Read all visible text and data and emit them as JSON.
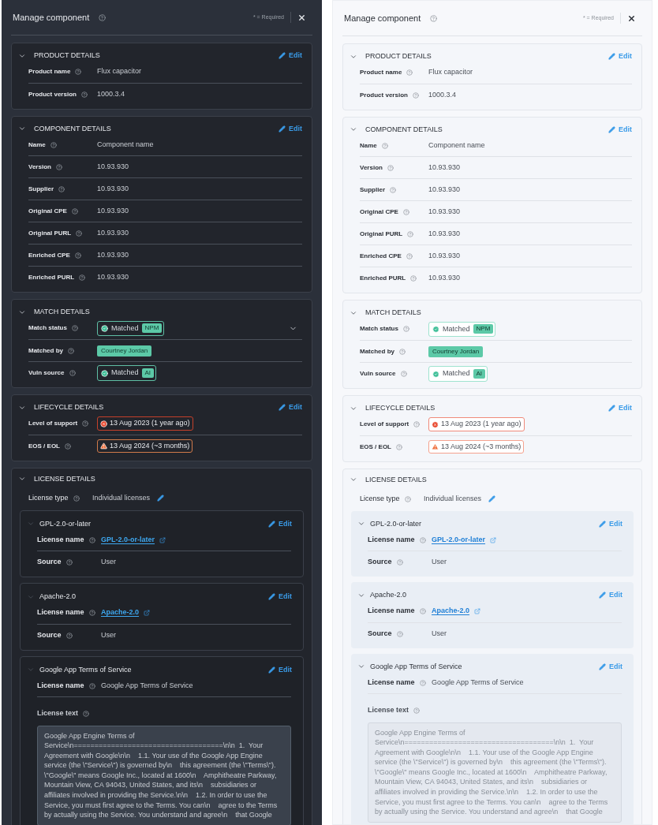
{
  "panels": [
    {
      "kind": "dark",
      "title": "Manage component",
      "required_note": "* = Required",
      "sections": [
        {
          "title": "PRODUCT DETAILS",
          "edit": "Edit",
          "rows": [
            {
              "kind": "text",
              "label": "Product name",
              "value": "Flux capacitor"
            },
            {
              "kind": "text",
              "label": "Product version",
              "value": "1000.3.4"
            }
          ]
        },
        {
          "title": "COMPONENT DETAILS",
          "edit": "Edit",
          "rows": [
            {
              "kind": "text",
              "label": "Name",
              "value": "Component name"
            },
            {
              "kind": "text",
              "label": "Version",
              "value": "10.93.930"
            },
            {
              "kind": "text",
              "label": "Supplier",
              "value": "10.93.930"
            },
            {
              "kind": "text",
              "label": "Original CPE",
              "value": "10.93.930"
            },
            {
              "kind": "text",
              "label": "Original PURL",
              "value": "10.93.930"
            },
            {
              "kind": "text",
              "label": "Enriched CPE",
              "value": "10.93.930"
            },
            {
              "kind": "text",
              "label": "Enriched PURL",
              "value": "10.93.930"
            }
          ]
        },
        {
          "title": "MATCH DETAILS",
          "rows": [
            {
              "kind": "status",
              "label": "Match status",
              "value": "Matched",
              "tag": "NPM",
              "dropdown": true
            },
            {
              "kind": "chip",
              "label": "Matched by",
              "value": "Courtney Jordan"
            },
            {
              "kind": "status",
              "label": "Vuln source",
              "value": "Matched",
              "tag": "AI",
              "dropdown": false
            }
          ]
        },
        {
          "title": "LIFECYCLE DETAILS",
          "edit": "Edit",
          "rows": [
            {
              "kind": "expired",
              "label": "Level of support",
              "value": "13 Aug 2023 (1 year ago)"
            },
            {
              "kind": "expiring",
              "label": "EOS / EOL",
              "value": "13 Aug 2024 (~3 months)"
            }
          ]
        }
      ],
      "license": {
        "title": "LICENSE DETAILS",
        "type_label": "License type",
        "type_value": "Individual licenses",
        "licenses": [
          {
            "title": "GPL-2.0-or-later",
            "edit": "Edit",
            "rows": [
              {
                "kind": "link",
                "label": "License name",
                "value": "GPL-2.0-or-later"
              },
              {
                "kind": "text",
                "label": "Source",
                "value": "User"
              }
            ]
          },
          {
            "title": "Apache-2.0",
            "edit": "Edit",
            "rows": [
              {
                "kind": "link",
                "label": "License name",
                "value": "Apache-2.0"
              },
              {
                "kind": "text",
                "label": "Source",
                "value": "User"
              }
            ]
          },
          {
            "title": "Google App Terms of Service",
            "edit": "Edit",
            "rows": [
              {
                "kind": "text",
                "label": "License name",
                "value": "Google App Terms of Service"
              },
              {
                "kind": "longtext",
                "label": "License text",
                "value": "Google App Engine Terms of\nService\\n====================================\\n\\n  1.  Your\nAgreement with Google\\n\\n    1.1. Your use of the Google App Engine\nservice (the \\\"Service\\\") is governed by\\n    this agreement (the \\\"Terms\\\").\n\\\"Google\\\" means Google Inc., located at 1600\\n    Amphitheatre Parkway,\nMountain View, CA 94043, United States, and its\\n    subsidiaries or\naffiliates involved in providing the Service.\\n\\n    1.2. In order to use the\nService, you must first agree to the Terms. You can\\n    agree to the Terms\nby actually using the Service. You understand and agree\\n    that Google"
              }
            ]
          }
        ]
      }
    },
    {
      "kind": "light",
      "title": "Manage component",
      "required_note": "* = Required",
      "sections": [
        {
          "title": "PRODUCT DETAILS",
          "edit": "Edit",
          "rows": [
            {
              "kind": "text",
              "label": "Product name",
              "value": "Flux capacitor"
            },
            {
              "kind": "text",
              "label": "Product version",
              "value": "1000.3.4"
            }
          ]
        },
        {
          "title": "COMPONENT DETAILS",
          "edit": "Edit",
          "rows": [
            {
              "kind": "text",
              "label": "Name",
              "value": "Component name"
            },
            {
              "kind": "text",
              "label": "Version",
              "value": "10.93.930"
            },
            {
              "kind": "text",
              "label": "Supplier",
              "value": "10.93.930"
            },
            {
              "kind": "text",
              "label": "Original CPE",
              "value": "10.93.930"
            },
            {
              "kind": "text",
              "label": "Original PURL",
              "value": "10.93.930"
            },
            {
              "kind": "text",
              "label": "Enriched CPE",
              "value": "10.93.930"
            },
            {
              "kind": "text",
              "label": "Enriched PURL",
              "value": "10.93.930"
            }
          ]
        },
        {
          "title": "MATCH DETAILS",
          "rows": [
            {
              "kind": "status",
              "label": "Match status",
              "value": "Matched",
              "tag": "NPM",
              "dropdown": false
            },
            {
              "kind": "chip",
              "label": "Matched by",
              "value": "Courtney Jordan"
            },
            {
              "kind": "status",
              "label": "Vuln source",
              "value": "Matched",
              "tag": "AI",
              "dropdown": false
            }
          ]
        },
        {
          "title": "LIFECYCLE DETAILS",
          "edit": "Edit",
          "rows": [
            {
              "kind": "expired",
              "label": "Level of support",
              "value": "13 Aug 2023 (1 year ago)"
            },
            {
              "kind": "expiring",
              "label": "EOS / EOL",
              "value": "13 Aug 2024 (~3 months)"
            }
          ]
        }
      ],
      "license": {
        "title": "LICENSE DETAILS",
        "type_label": "License type",
        "type_value": "Individual licenses",
        "licenses": [
          {
            "title": "GPL-2.0-or-later",
            "edit": "Edit",
            "rows": [
              {
                "kind": "link",
                "label": "License name",
                "value": "GPL-2.0-or-later"
              },
              {
                "kind": "text",
                "label": "Source",
                "value": "User"
              }
            ]
          },
          {
            "title": "Apache-2.0",
            "edit": "Edit",
            "rows": [
              {
                "kind": "link",
                "label": "License name",
                "value": "Apache-2.0"
              },
              {
                "kind": "text",
                "label": "Source",
                "value": "User"
              }
            ]
          },
          {
            "title": "Google App Terms of Service",
            "edit": "Edit",
            "rows": [
              {
                "kind": "text",
                "label": "License name",
                "value": "Google App Terms of Service"
              },
              {
                "kind": "longtext",
                "label": "License text",
                "value": "Google App Engine Terms of\nService\\n====================================\\n\\n  1.  Your\nAgreement with Google\\n\\n    1.1. Your use of the Google App Engine\nservice (the \\\"Service\\\") is governed by\\n    this agreement (the \\\"Terms\\\").\n\\\"Google\\\" means Google Inc., located at 1600\\n    Amphitheatre Parkway,\nMountain View, CA 94043, United States, and its\\n    subsidiaries or\naffiliates involved in providing the Service.\\n\\n    1.2. In order to use the\nService, you must first agree to the Terms. You can\\n    agree to the Terms\nby actually using the Service. You understand and agree\\n    that Google"
              }
            ]
          }
        ]
      }
    }
  ]
}
